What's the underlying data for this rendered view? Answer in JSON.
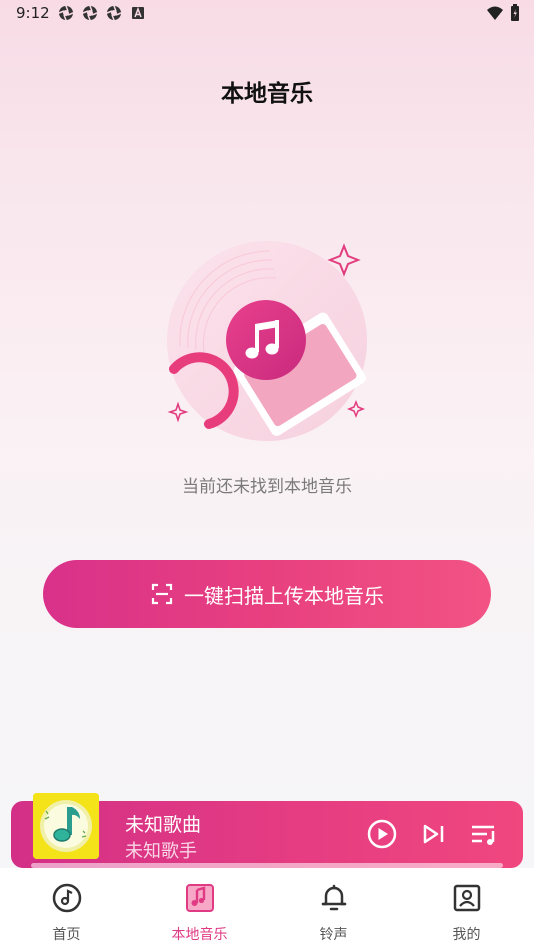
{
  "status_bar": {
    "time": "9:12",
    "left_icons": [
      "aperture-icon",
      "aperture-icon",
      "aperture-icon",
      "a-box-icon"
    ],
    "right_icons": [
      "wifi-icon",
      "battery-charging-icon"
    ]
  },
  "page": {
    "title": "本地音乐",
    "empty_message": "当前还未找到本地音乐",
    "scan_button_label": "一键扫描上传本地音乐"
  },
  "mini_player": {
    "song_title": "未知歌曲",
    "artist": "未知歌手",
    "controls": [
      "play-icon",
      "skip-next-icon",
      "playlist-icon"
    ]
  },
  "tab_bar": {
    "items": [
      {
        "label": "首页",
        "icon": "music-disc-icon",
        "active": false
      },
      {
        "label": "本地音乐",
        "icon": "music-note-card-icon",
        "active": true
      },
      {
        "label": "铃声",
        "icon": "bell-icon",
        "active": false
      },
      {
        "label": "我的",
        "icon": "profile-card-icon",
        "active": false
      }
    ]
  },
  "colors": {
    "accent": "#e03a84",
    "button_gradient_start": "#d9318a",
    "button_gradient_end": "#f25384",
    "album_art_bg": "#f5e31a"
  }
}
